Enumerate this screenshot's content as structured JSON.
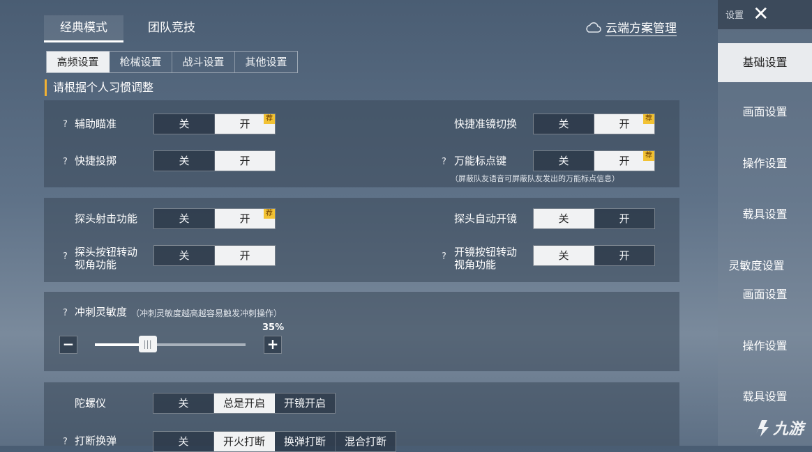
{
  "mode_tabs": [
    {
      "label": "经典模式"
    },
    {
      "label": "团队竞技"
    }
  ],
  "cloud": {
    "label": "云端方案管理",
    "icon": "cloud-icon"
  },
  "sub_tabs": [
    {
      "label": "高频设置"
    },
    {
      "label": "枪械设置"
    },
    {
      "label": "战斗设置"
    },
    {
      "label": "其他设置"
    }
  ],
  "hint": "请根据个人习惯调整",
  "rows": {
    "aim_assist": {
      "label": "辅助瞄准",
      "off": "关",
      "on": "开",
      "badge": "荐",
      "q": "?"
    },
    "scope_switch": {
      "label": "快捷准镜切换",
      "off": "关",
      "on": "开",
      "badge": "荐"
    },
    "quick_throw": {
      "label": "快捷投掷",
      "off": "关",
      "on": "开",
      "q": "?"
    },
    "universal_mark": {
      "label": "万能标点键",
      "off": "关",
      "on": "开",
      "badge": "荐",
      "q": "?",
      "note": "（屏蔽队友语音可屏蔽队友发出的万能标点信息）"
    },
    "peek_fire": {
      "label": "探头射击功能",
      "off": "关",
      "on": "开",
      "badge": "荐"
    },
    "peek_auto_scope": {
      "label": "探头自动开镜",
      "off": "关",
      "on": "开"
    },
    "peek_rotate": {
      "line1": "探头按钮转动",
      "line2": "视角功能",
      "off": "关",
      "on": "开",
      "q": "?"
    },
    "scope_rotate": {
      "line1": "开镜按钮转动",
      "line2": "视角功能",
      "off": "关",
      "on": "开",
      "q": "?"
    }
  },
  "sprint": {
    "label": "冲刺灵敏度",
    "note": "（冲刺灵敏度越高越容易触发冲刺操作）",
    "value": 35,
    "value_label": "35%",
    "minus": "−",
    "plus": "+",
    "q": "?"
  },
  "gyro": {
    "label": "陀螺仪",
    "options": [
      "关",
      "总是开启",
      "开镜开启"
    ]
  },
  "reload_interrupt": {
    "label": "打断换弹",
    "options": [
      "关",
      "开火打断",
      "换弹打断",
      "混合打断"
    ],
    "q": "?"
  },
  "sidebar": {
    "settings_label": "设置",
    "close": "✕",
    "items": [
      {
        "label": "基础设置"
      },
      {
        "label": "画面设置"
      },
      {
        "label": "操作设置"
      },
      {
        "label": "载具设置"
      },
      {
        "label": "灵敏度设置"
      },
      {
        "label": "画面设置"
      },
      {
        "label": "操作设置"
      },
      {
        "label": "载具设置"
      }
    ]
  },
  "watermark": "九游"
}
